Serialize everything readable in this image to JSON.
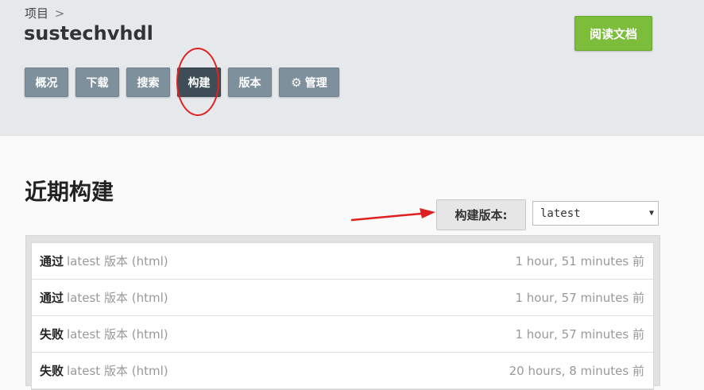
{
  "header": {
    "breadcrumb": "项目",
    "breadcrumb_sep": ">",
    "project_name": "sustechvhdl",
    "read_docs": "阅读文档"
  },
  "nav": {
    "overview": "概况",
    "downloads": "下载",
    "search": "搜索",
    "builds": "构建",
    "versions": "版本",
    "admin": "管理"
  },
  "main": {
    "title": "近期构建",
    "version_label": "构建版本:",
    "version_selected": "latest"
  },
  "builds": [
    {
      "status": "通过",
      "desc": "latest 版本 (html)",
      "time": "1 hour, 51 minutes 前"
    },
    {
      "status": "通过",
      "desc": "latest 版本 (html)",
      "time": "1 hour, 57 minutes 前"
    },
    {
      "status": "失败",
      "desc": "latest 版本 (html)",
      "time": "1 hour, 57 minutes 前"
    },
    {
      "status": "失败",
      "desc": "latest 版本 (html)",
      "time": "20 hours, 8 minutes 前"
    }
  ],
  "colors": {
    "accent_green": "#7cbd3b",
    "nav_button": "#7f909d",
    "nav_active": "#3f4d57",
    "annotation_red": "#e02020"
  },
  "icons": {
    "admin": "gear-icon",
    "select": "caret-down-icon"
  }
}
